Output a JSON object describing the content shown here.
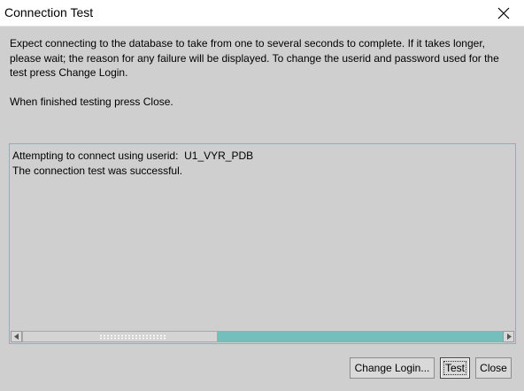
{
  "window": {
    "title": "Connection Test"
  },
  "instructions": {
    "line1": "Expect connecting to the database to take from one to several seconds to complete. If it takes longer,",
    "line2": "please wait; the reason for any failure will be displayed. To change the userid and password used for the",
    "line3": "test press Change Login.",
    "line4": "When finished testing press Close."
  },
  "output": {
    "lines": [
      "Attempting to connect using userid:  U1_VYR_PDB",
      "The connection test was successful."
    ]
  },
  "buttons": {
    "change_login": "Change Login...",
    "test": "Test",
    "close": "Close"
  },
  "icons": {
    "close": "close-icon",
    "scroll_left": "triangle-left-icon",
    "scroll_right": "triangle-right-icon"
  },
  "colors": {
    "background": "#cfcfcf",
    "scroll_track": "#74bebb",
    "panel_border": "#7fb8b5"
  }
}
